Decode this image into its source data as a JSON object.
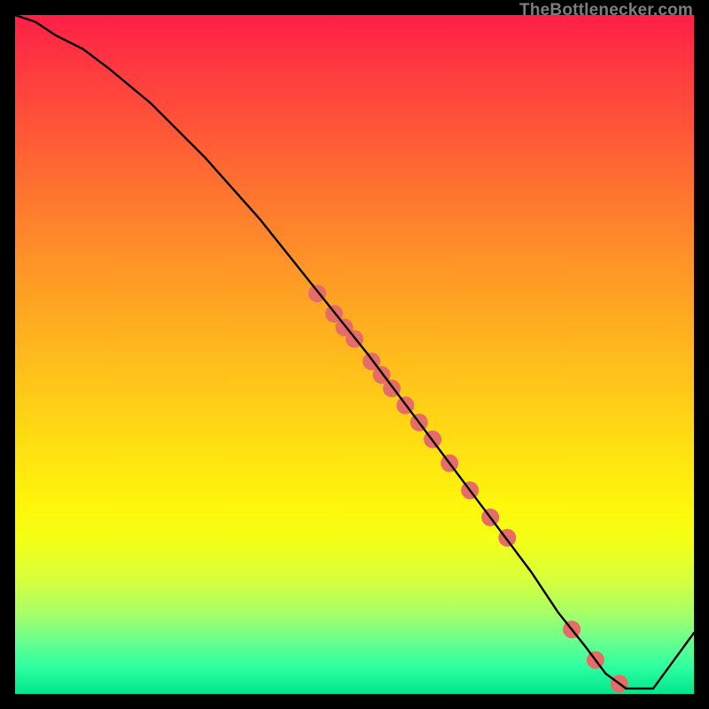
{
  "attribution": "TheBottlenecker.com",
  "chart_data": {
    "type": "line",
    "title": "",
    "xlabel": "",
    "ylabel": "",
    "xlim": [
      0,
      100
    ],
    "ylim": [
      0,
      100
    ],
    "series": [
      {
        "name": "curve",
        "x": [
          0,
          3,
          6,
          10,
          14,
          20,
          28,
          36,
          44,
          52,
          58,
          64,
          70,
          76,
          80,
          84,
          87,
          90,
          94,
          100
        ],
        "y": [
          100,
          99,
          97,
          95,
          92,
          87,
          79,
          70,
          60,
          50,
          42,
          34,
          26,
          18,
          12,
          7,
          3,
          0.8,
          0.8,
          9
        ]
      }
    ],
    "markers": {
      "name": "data-points",
      "color": "#e76b66",
      "radius": 10,
      "x": [
        44.5,
        47.0,
        48.5,
        50.0,
        52.5,
        54.0,
        55.5,
        57.5,
        59.5,
        61.5,
        64.0,
        67.0,
        70.0,
        72.5,
        82.0,
        85.5,
        89.0
      ],
      "y": [
        59.0,
        56.0,
        54.0,
        52.3,
        49.0,
        47.0,
        45.0,
        42.5,
        40.0,
        37.5,
        34.0,
        30.0,
        26.0,
        23.0,
        9.5,
        5.0,
        1.5
      ]
    },
    "gradient_stops": [
      {
        "pct": 0,
        "color": "#ff1f47"
      },
      {
        "pct": 50,
        "color": "#ffd016"
      },
      {
        "pct": 75,
        "color": "#fff60a"
      },
      {
        "pct": 100,
        "color": "#00e58c"
      }
    ]
  }
}
